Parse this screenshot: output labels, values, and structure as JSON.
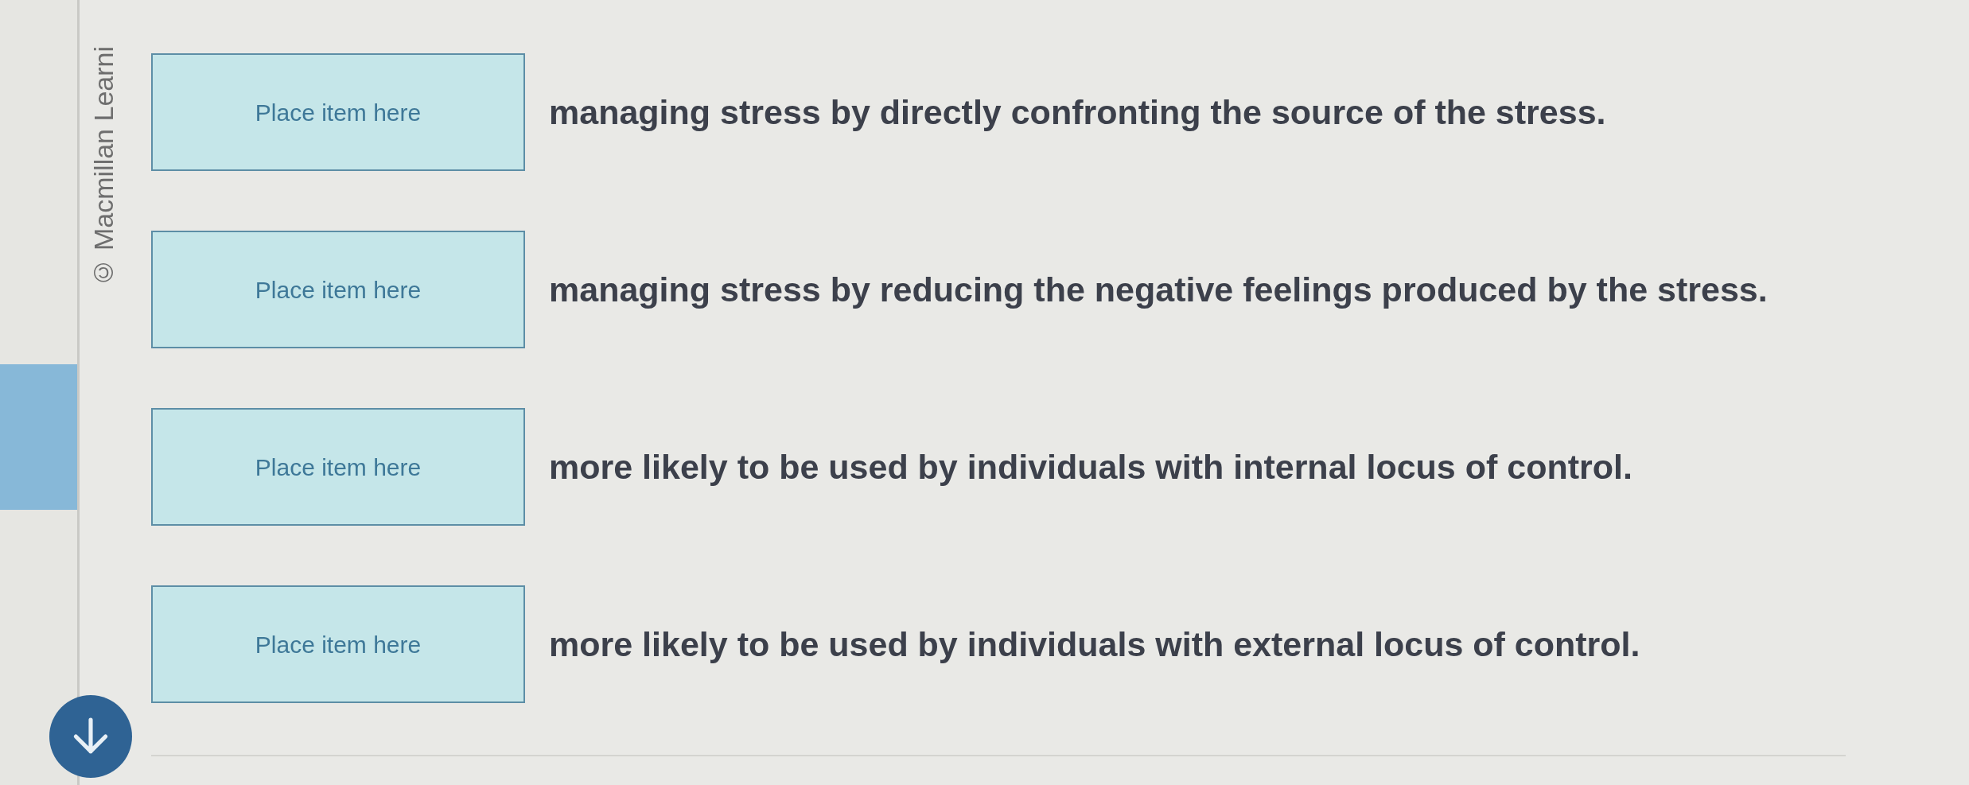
{
  "sidebar": {
    "copyright": "© Macmillan Learni"
  },
  "rows": [
    {
      "target": {
        "label": "Place item here"
      },
      "statement": "managing stress by directly confronting the source of the stress."
    },
    {
      "target": {
        "label": "Place item here"
      },
      "statement": "managing stress by reducing the negative feelings produced by the stress."
    },
    {
      "target": {
        "label": "Place item here"
      },
      "statement": "more likely to be used by individuals with internal locus of control."
    },
    {
      "target": {
        "label": "Place item here"
      },
      "statement": "more likely to be used by individuals with external locus of control."
    }
  ]
}
